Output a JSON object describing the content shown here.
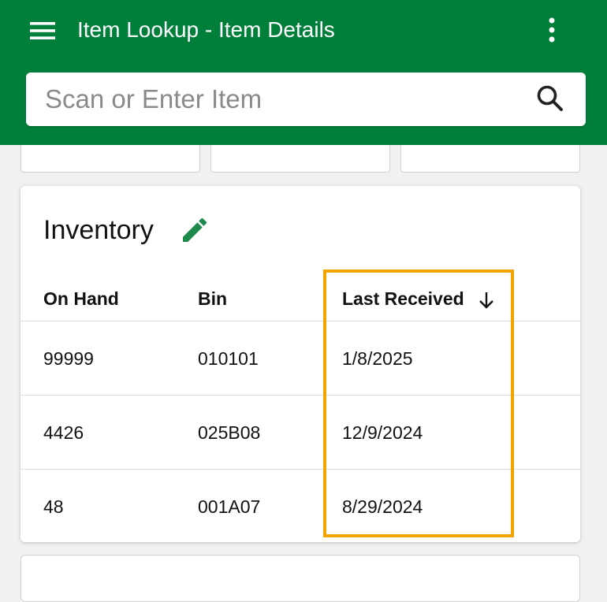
{
  "app_bar": {
    "title": "Item Lookup - Item Details",
    "menu_icon": "hamburger-menu-icon",
    "more_icon": "more-vertical-icon",
    "background_color": "#007f3b"
  },
  "search": {
    "placeholder": "Scan or Enter Item",
    "value": "",
    "icon": "search-icon"
  },
  "inventory": {
    "title": "Inventory",
    "edit_icon": "pencil-icon",
    "edit_icon_color": "#1e8a4c",
    "columns": {
      "on_hand": "On Hand",
      "bin": "Bin",
      "last_received": "Last Received"
    },
    "sort": {
      "column": "last_received",
      "direction": "descending",
      "icon": "arrow-down-icon"
    },
    "rows": [
      {
        "on_hand": "99999",
        "bin": "010101",
        "last_received": "1/8/2025"
      },
      {
        "on_hand": "4426",
        "bin": "025B08",
        "last_received": "12/9/2024"
      },
      {
        "on_hand": "48",
        "bin": "001A07",
        "last_received": "8/29/2024"
      }
    ]
  },
  "highlight_color": "#f4a300"
}
